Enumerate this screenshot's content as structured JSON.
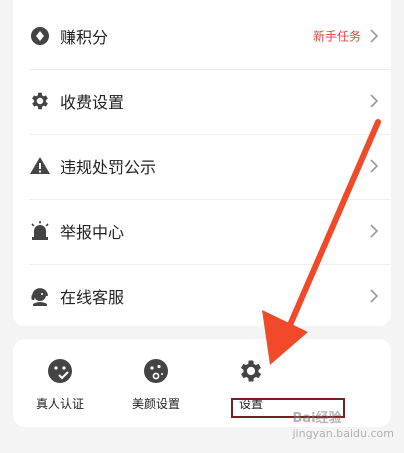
{
  "menu": {
    "items": [
      {
        "label": "赚积分",
        "badge": "新手任务",
        "icon": "diamond-icon"
      },
      {
        "label": "收费设置",
        "badge": "",
        "icon": "gear-icon"
      },
      {
        "label": "违规处罚公示",
        "badge": "",
        "icon": "warning-icon"
      },
      {
        "label": "举报中心",
        "badge": "",
        "icon": "siren-icon"
      },
      {
        "label": "在线客服",
        "badge": "",
        "icon": "support-agent-icon"
      }
    ]
  },
  "tools": {
    "items": [
      {
        "label": "真人认证",
        "icon": "verified-face-icon"
      },
      {
        "label": "美颜设置",
        "icon": "beauty-face-icon"
      },
      {
        "label": "设置",
        "icon": "gear-icon"
      }
    ]
  },
  "watermark": {
    "text": "Bai",
    "suffix": "经验",
    "sub": "jingyan.baidu.com"
  },
  "colors": {
    "badge": "#e0453a",
    "icon": "#444444",
    "arrow": "#f04a2a",
    "highlight": "#7a1f1f"
  }
}
